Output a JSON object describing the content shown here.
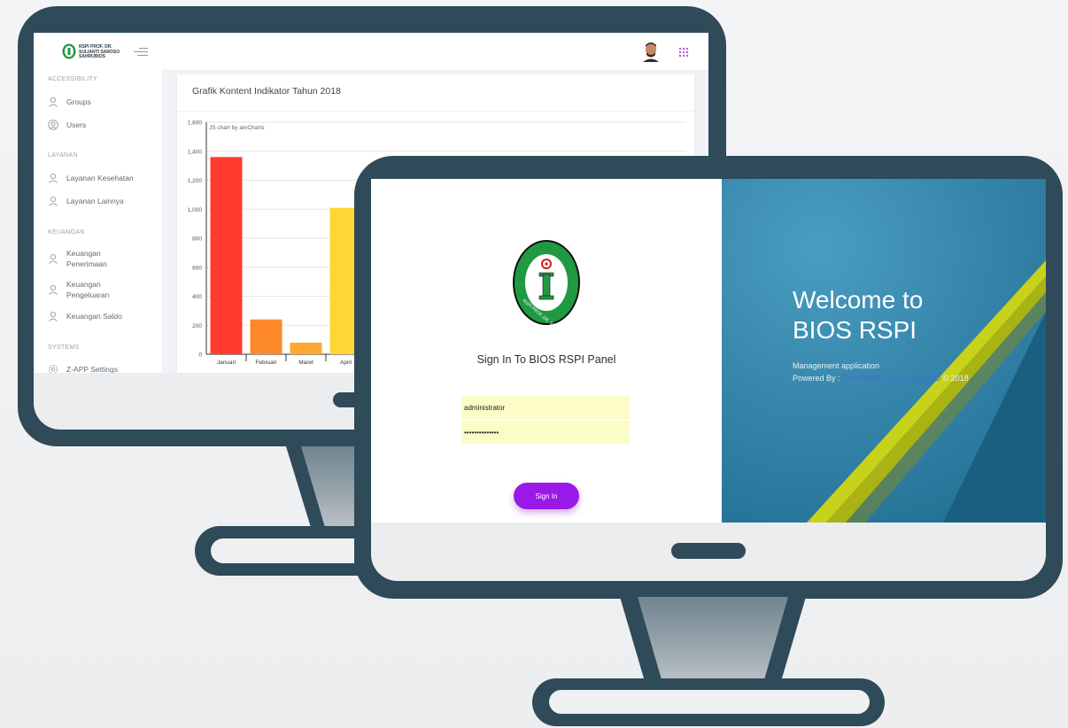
{
  "back_screen": {
    "brand": {
      "line1": "RSPI PROF. DR.",
      "line2": "SULIANTI SAROSO",
      "line3": "SAHRUBIOS"
    },
    "sidebar": {
      "sections": [
        {
          "title": "ACCESSIBILITY",
          "items": [
            {
              "label": "Groups",
              "icon": "user-icon"
            },
            {
              "label": "Users",
              "icon": "user-circle-icon"
            }
          ]
        },
        {
          "title": "LAYANAN",
          "items": [
            {
              "label": "Layanan Kesehatan",
              "icon": "user-icon"
            },
            {
              "label": "Layanan Lainnya",
              "icon": "user-icon"
            }
          ]
        },
        {
          "title": "KEUANGAN",
          "items": [
            {
              "label": "Keuangan Penerimaan",
              "icon": "user-icon"
            },
            {
              "label": "Keuangan Pengeluaran",
              "icon": "user-icon"
            },
            {
              "label": "Keuangan Saldo",
              "icon": "user-icon"
            }
          ]
        },
        {
          "title": "SYSTEMS",
          "items": [
            {
              "label": "Z-APP Settings",
              "icon": "gear-icon"
            }
          ]
        }
      ]
    },
    "chart_card": {
      "title": "Grafik Kontent Indikator Tahun 2018",
      "credit": "JS chart by amCharts"
    }
  },
  "chart_data": {
    "type": "bar",
    "title": "Grafik Kontent Indikator Tahun 2018",
    "categories": [
      "Januari",
      "Februari",
      "Maret",
      "April"
    ],
    "values": [
      1360,
      240,
      80,
      1010
    ],
    "colors": [
      "#ff3b2f",
      "#ff8a2a",
      "#ffa933",
      "#fdd835"
    ],
    "yticks": [
      0,
      200,
      400,
      600,
      800,
      1000,
      1200,
      1400,
      1600
    ],
    "ytick_labels": [
      "0",
      "200",
      "400",
      "600",
      "800",
      "1,000",
      "1,200",
      "1,400",
      "1,600"
    ],
    "ylim": [
      0,
      1600
    ],
    "grid": true
  },
  "front_screen": {
    "signin_title": "Sign In To BIOS RSPI Panel",
    "username_value": "administrator",
    "password_value": "••••••••••••••",
    "signin_button": "Sign In",
    "welcome_line1": "Welcome to",
    "welcome_line2": "BIOS RSPI",
    "subtitle": "Management application",
    "powered_prefix": "Powered By :",
    "powered_link": "ShahRBIOS SaRoHSaHRU",
    "powered_suffix": "© 2018",
    "logo_text": "RSPI PROF. DR. SULIANTI SAROSO",
    "colors": {
      "accent": "#9a18e8",
      "input_bg": "#fbfcc6",
      "panel_blue": "#3686ab",
      "logo_green": "#1f9a43"
    }
  }
}
